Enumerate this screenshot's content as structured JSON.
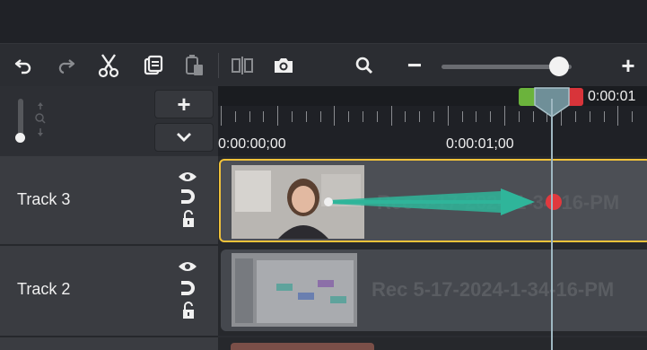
{
  "toolbar": {
    "undo": "undo-icon",
    "redo": "redo-icon",
    "cut": "scissors-icon",
    "copy": "copy-icon",
    "paste": "paste-icon",
    "split": "split-icon",
    "snapshot": "camera-icon",
    "zoom": "magnifier-icon",
    "zoom_out_label": "−",
    "zoom_in_label": "+",
    "zoom_level": 0.9
  },
  "track_controls": {
    "add_label": "+",
    "collapse_icon": "chevron-down-icon"
  },
  "ruler": {
    "times": [
      "0:00:00;00",
      "0:00:01;00"
    ],
    "playhead_time": "0:00:01"
  },
  "tracks": [
    {
      "label": "Track 3",
      "clip_title": "Rec 5-17-2024-1-34-16-PM",
      "selected": true
    },
    {
      "label": "Track 2",
      "clip_title": "Rec 5-17-2024-1-34-16-PM",
      "selected": false
    }
  ],
  "colors": {
    "accent": "#f0c23a",
    "playhead": "#6f8f98",
    "animation_arrow": "#2fb59a",
    "keyframe": "#e0393e",
    "in_marker": "#6bb33c",
    "out_marker": "#d8343a"
  }
}
